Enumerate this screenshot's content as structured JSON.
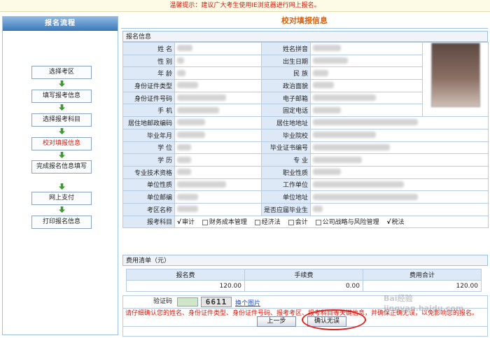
{
  "notice": "温馨提示：建议广大考生使用IE浏览器进行网上报名。",
  "sidebar": {
    "title": "报名流程",
    "steps": [
      "选择考区",
      "填写报考信息",
      "选择报考科目",
      "校对填报信息",
      "完成报名信息填写",
      "网上支付",
      "打印报名信息"
    ]
  },
  "main": {
    "title": "校对填报信息",
    "section_info": "报名信息",
    "labels": {
      "name": "姓 名",
      "name_pinyin": "姓名拼音",
      "gender": "性 别",
      "birth_date": "出生日期",
      "age": "年 龄",
      "ethnicity": "民 族",
      "id_type": "身份证件类型",
      "political": "政治面貌",
      "id_number": "身份证件号码",
      "email": "电子邮箱",
      "mobile": "手 机",
      "phone": "固定电话",
      "postcode": "居住地邮政编码",
      "address": "居住地地址",
      "grad_date": "毕业年月",
      "school": "毕业院校",
      "degree": "学 位",
      "cert_no": "毕业证书编号",
      "education": "学 历",
      "major": "专 业",
      "title_level": "专业技术资格",
      "job_title": "职业性质",
      "unit_type": "单位性质",
      "workplace": "工作单位",
      "unit_zip": "单位邮编",
      "unit_address": "单位地址",
      "exam_area": "考区名称",
      "fresh_grad": "是否应届毕业生",
      "subjects": "报考科目"
    },
    "subjects": [
      {
        "name": "审计",
        "checked": "√"
      },
      {
        "name": "财务成本管理",
        "checked": ""
      },
      {
        "name": "经济法",
        "checked": ""
      },
      {
        "name": "会计",
        "checked": ""
      },
      {
        "name": "公司战略与风险管理",
        "checked": ""
      },
      {
        "name": "税法",
        "checked": "√"
      }
    ],
    "fee": {
      "title": "费用清单（元）",
      "headers": [
        "报名费",
        "手续费",
        "费用合计"
      ],
      "values": [
        "120.00",
        "0.00",
        "120.00"
      ]
    },
    "captcha": {
      "label": "验证码",
      "code": "6611",
      "refresh": "换个图片"
    },
    "warning": "请仔细确认您的姓名、身份证件类型、身份证件号码、报考考区、报考科目等关键信息，并确保正确无误，以免影响您的报名。",
    "buttons": {
      "prev": "上一步",
      "confirm": "确认无误"
    },
    "watermark": "Bai经验 jingyan.baidu.com"
  },
  "colors": {
    "accent": "#d9610b",
    "warning": "#d21a0e",
    "label_bg": "#dde9f6",
    "border": "#b5cce3"
  }
}
